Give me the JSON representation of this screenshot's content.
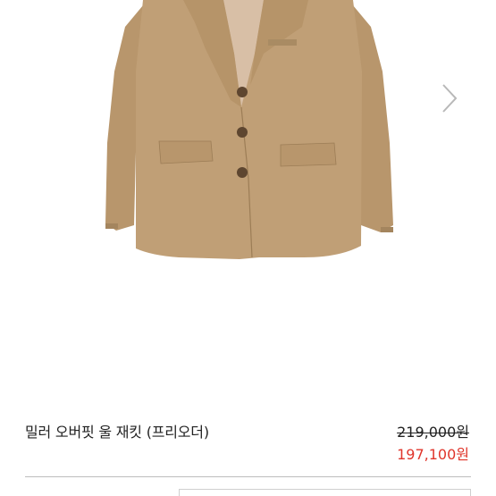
{
  "product": {
    "image_alt_icon": "camel-wool-jacket-image",
    "name": "밀러 오버핏 울 재킷 (프리오더)",
    "price_original": "219,000원",
    "price_sale": "197,100원"
  },
  "colors": {
    "jacket": "#c09f76",
    "sale_price": "#e0352b",
    "text": "#222222",
    "arrow": "#b8b8b8"
  },
  "gallery": {
    "next_icon": "chevron-right-icon"
  }
}
